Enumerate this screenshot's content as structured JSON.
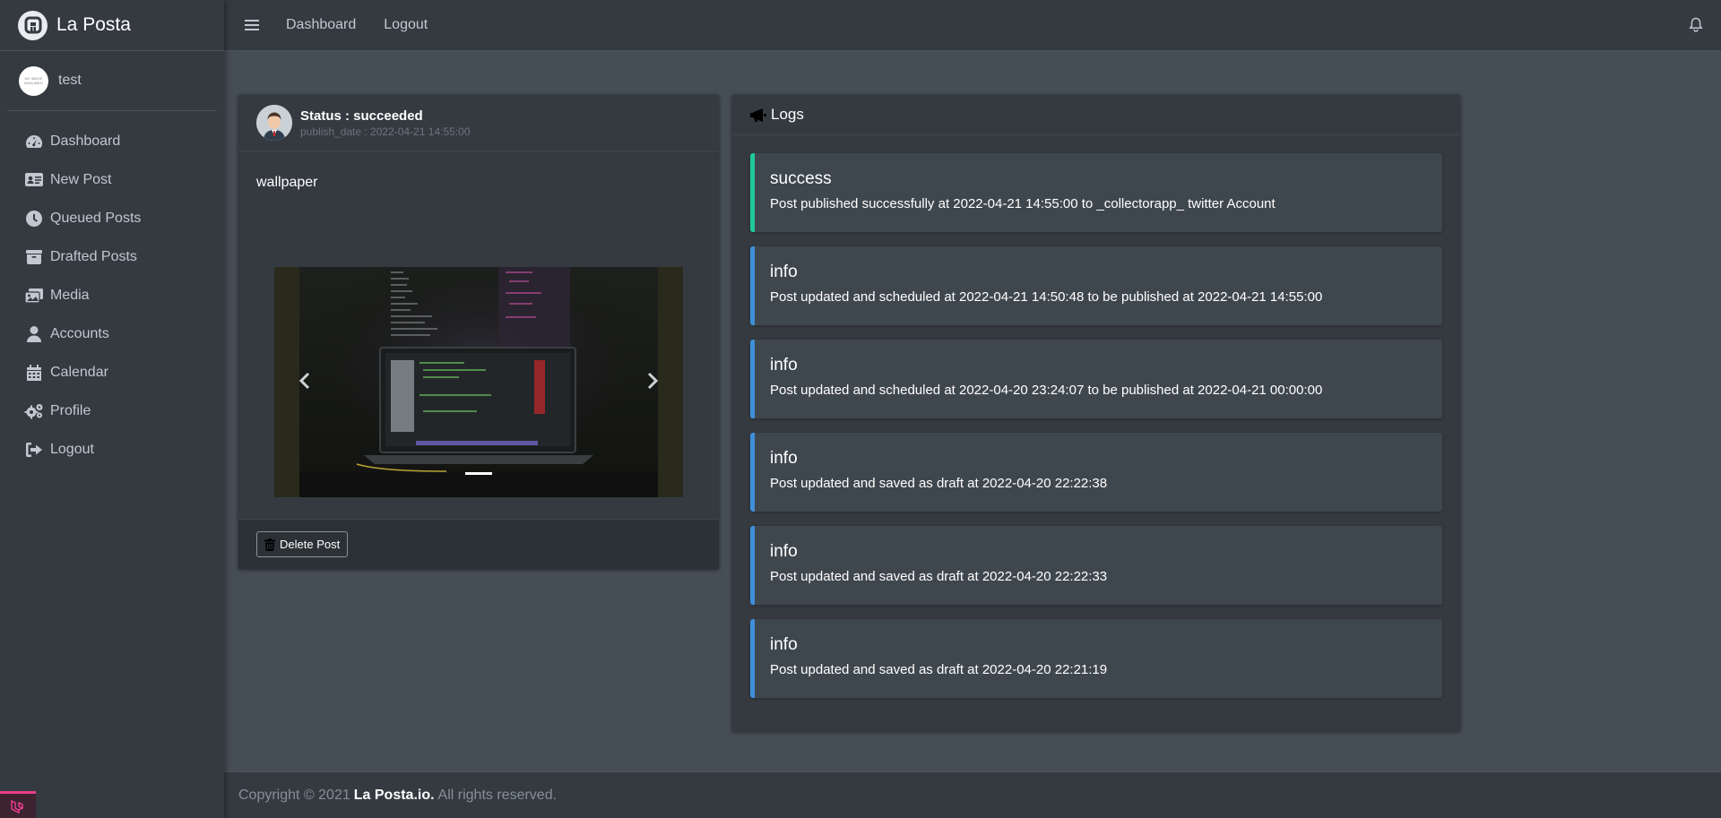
{
  "brand": {
    "name": "La Posta"
  },
  "user": {
    "name": "test",
    "avatar_text": "NO IMAGE AVAILABLE"
  },
  "sidebar": {
    "items": [
      {
        "label": "Dashboard",
        "icon": "tachometer-icon"
      },
      {
        "label": "New Post",
        "icon": "id-card-icon"
      },
      {
        "label": "Queued Posts",
        "icon": "clock-icon"
      },
      {
        "label": "Drafted Posts",
        "icon": "archive-icon"
      },
      {
        "label": "Media",
        "icon": "images-icon"
      },
      {
        "label": "Accounts",
        "icon": "user-icon"
      },
      {
        "label": "Calendar",
        "icon": "calendar-icon"
      },
      {
        "label": "Profile",
        "icon": "cogs-icon"
      },
      {
        "label": "Logout",
        "icon": "sign-out-icon"
      }
    ]
  },
  "topbar": {
    "links": [
      "Dashboard",
      "Logout"
    ]
  },
  "post": {
    "status": "Status : succeeded",
    "publish_date": "publish_date : 2022-04-21 14:55:00",
    "text": "wallpaper",
    "delete_label": "Delete Post"
  },
  "logs": {
    "title": "Logs",
    "items": [
      {
        "type": "success",
        "message": "Post published successfully at 2022-04-21 14:55:00 to _collectorapp_ twitter Account"
      },
      {
        "type": "info",
        "message": "Post updated and scheduled at 2022-04-21 14:50:48 to be published at 2022-04-21 14:55:00"
      },
      {
        "type": "info",
        "message": "Post updated and scheduled at 2022-04-20 23:24:07 to be published at 2022-04-21 00:00:00"
      },
      {
        "type": "info",
        "message": "Post updated and saved as draft at 2022-04-20 22:22:38"
      },
      {
        "type": "info",
        "message": "Post updated and saved as draft at 2022-04-20 22:22:33"
      },
      {
        "type": "info",
        "message": "Post updated and saved as draft at 2022-04-20 22:21:19"
      }
    ]
  },
  "footer": {
    "prefix": "Copyright © 2021",
    "brand": "La Posta.io.",
    "suffix": "All rights reserved."
  },
  "colors": {
    "sidebar_bg": "#343a40",
    "content_bg": "#454d55",
    "success": "#20c997",
    "info": "#3f8fd9",
    "accent": "#e83e8c"
  }
}
